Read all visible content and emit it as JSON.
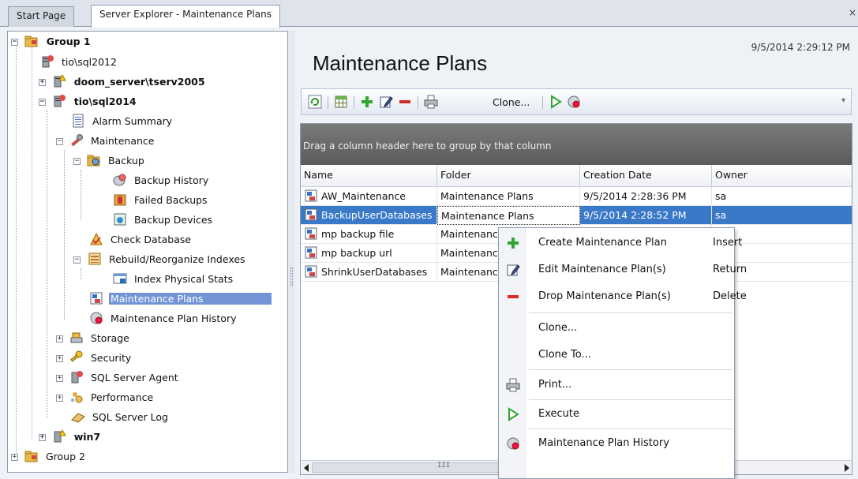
{
  "tabs": [
    {
      "label": "Start Page",
      "active": false
    },
    {
      "label": "Server Explorer - Maintenance Plans",
      "active": true
    }
  ],
  "tab_close": "×",
  "tree": {
    "group1": "Group 1",
    "server_tio2012": "tio\\sql2012",
    "server_doom": "doom_server\\tserv2005",
    "server_tio2014": "tio\\sql2014",
    "alarm_summary": "Alarm Summary",
    "maintenance": "Maintenance",
    "backup": "Backup",
    "backup_history": "Backup History",
    "failed_backups": "Failed Backups",
    "backup_devices": "Backup Devices",
    "check_database": "Check Database",
    "rebuild_indexes": "Rebuild/Reorganize Indexes",
    "index_physical_stats": "Index Physical Stats",
    "maintenance_plans": "Maintenance Plans",
    "maintenance_plan_history": "Maintenance Plan History",
    "storage": "Storage",
    "security": "Security",
    "sql_server_agent": "SQL Server Agent",
    "performance": "Performance",
    "sql_server_log": "SQL Server Log",
    "server_win7": "win7",
    "group2": "Group 2"
  },
  "header": {
    "title": "Maintenance Plans",
    "timestamp": "9/5/2014 2:29:12 PM"
  },
  "toolbar": {
    "clone_label": "Clone..."
  },
  "grid": {
    "group_hint": "Drag a column header here to group by that column",
    "columns": [
      "Name",
      "Folder",
      "Creation Date",
      "Owner"
    ],
    "rows": [
      {
        "name": "AW_Maintenance",
        "folder": "Maintenance Plans",
        "date": "9/5/2014 2:28:36 PM",
        "owner": "sa"
      },
      {
        "name": "BackupUserDatabases",
        "folder": "Maintenance Plans",
        "date": "9/5/2014 2:28:52 PM",
        "owner": "sa"
      },
      {
        "name": "mp backup file",
        "folder": "Maintenance Plans",
        "date": "",
        "owner": ""
      },
      {
        "name": "mp backup url",
        "folder": "Maintenance Plans",
        "date": "",
        "owner": ""
      },
      {
        "name": "ShrinkUserDatabases",
        "folder": "Maintenance Plans",
        "date": "",
        "owner": ""
      }
    ],
    "scroll_grip": "III"
  },
  "context_menu": {
    "create": {
      "label": "Create Maintenance Plan",
      "key": "Insert"
    },
    "edit": {
      "label": "Edit Maintenance Plan(s)",
      "key": "Return"
    },
    "drop": {
      "label": "Drop Maintenance Plan(s)",
      "key": "Delete"
    },
    "clone": {
      "label": "Clone..."
    },
    "clone_to": {
      "label": "Clone To..."
    },
    "print": {
      "label": "Print..."
    },
    "execute": {
      "label": "Execute"
    },
    "history": {
      "label": "Maintenance Plan History"
    }
  },
  "colors": {
    "selection": "#3979c7",
    "tree_selection": "#7293d6",
    "add_green": "#2fa52f",
    "drop_red": "#d42a2a"
  }
}
